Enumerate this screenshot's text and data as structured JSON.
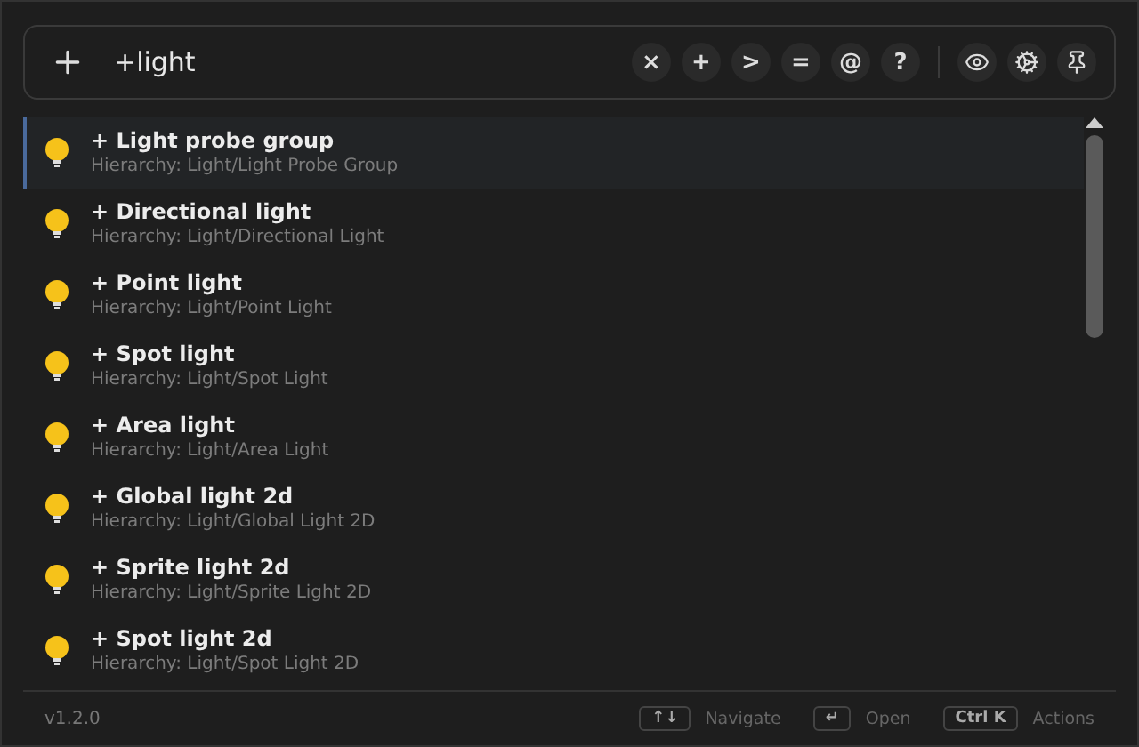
{
  "search": {
    "value": "+light"
  },
  "filters": [
    "×",
    "+",
    ">",
    "=",
    "@",
    "?"
  ],
  "results": [
    {
      "title": "+ Light probe group",
      "path": "Hierarchy: Light/Light Probe Group",
      "selected": true
    },
    {
      "title": "+ Directional light",
      "path": "Hierarchy: Light/Directional Light",
      "selected": false
    },
    {
      "title": "+ Point light",
      "path": "Hierarchy: Light/Point Light",
      "selected": false
    },
    {
      "title": "+ Spot light",
      "path": "Hierarchy: Light/Spot Light",
      "selected": false
    },
    {
      "title": "+ Area light",
      "path": "Hierarchy: Light/Area Light",
      "selected": false
    },
    {
      "title": "+ Global light 2d",
      "path": "Hierarchy: Light/Global Light 2D",
      "selected": false
    },
    {
      "title": "+ Sprite light 2d",
      "path": "Hierarchy: Light/Sprite Light 2D",
      "selected": false
    },
    {
      "title": "+ Spot light 2d",
      "path": "Hierarchy: Light/Spot Light 2D",
      "selected": false
    }
  ],
  "footer": {
    "version": "v1.2.0",
    "shortcuts": [
      {
        "key": "↑↓",
        "label": "Navigate"
      },
      {
        "key": "↵",
        "label": "Open"
      },
      {
        "key": "Ctrl K",
        "label": "Actions"
      }
    ]
  }
}
